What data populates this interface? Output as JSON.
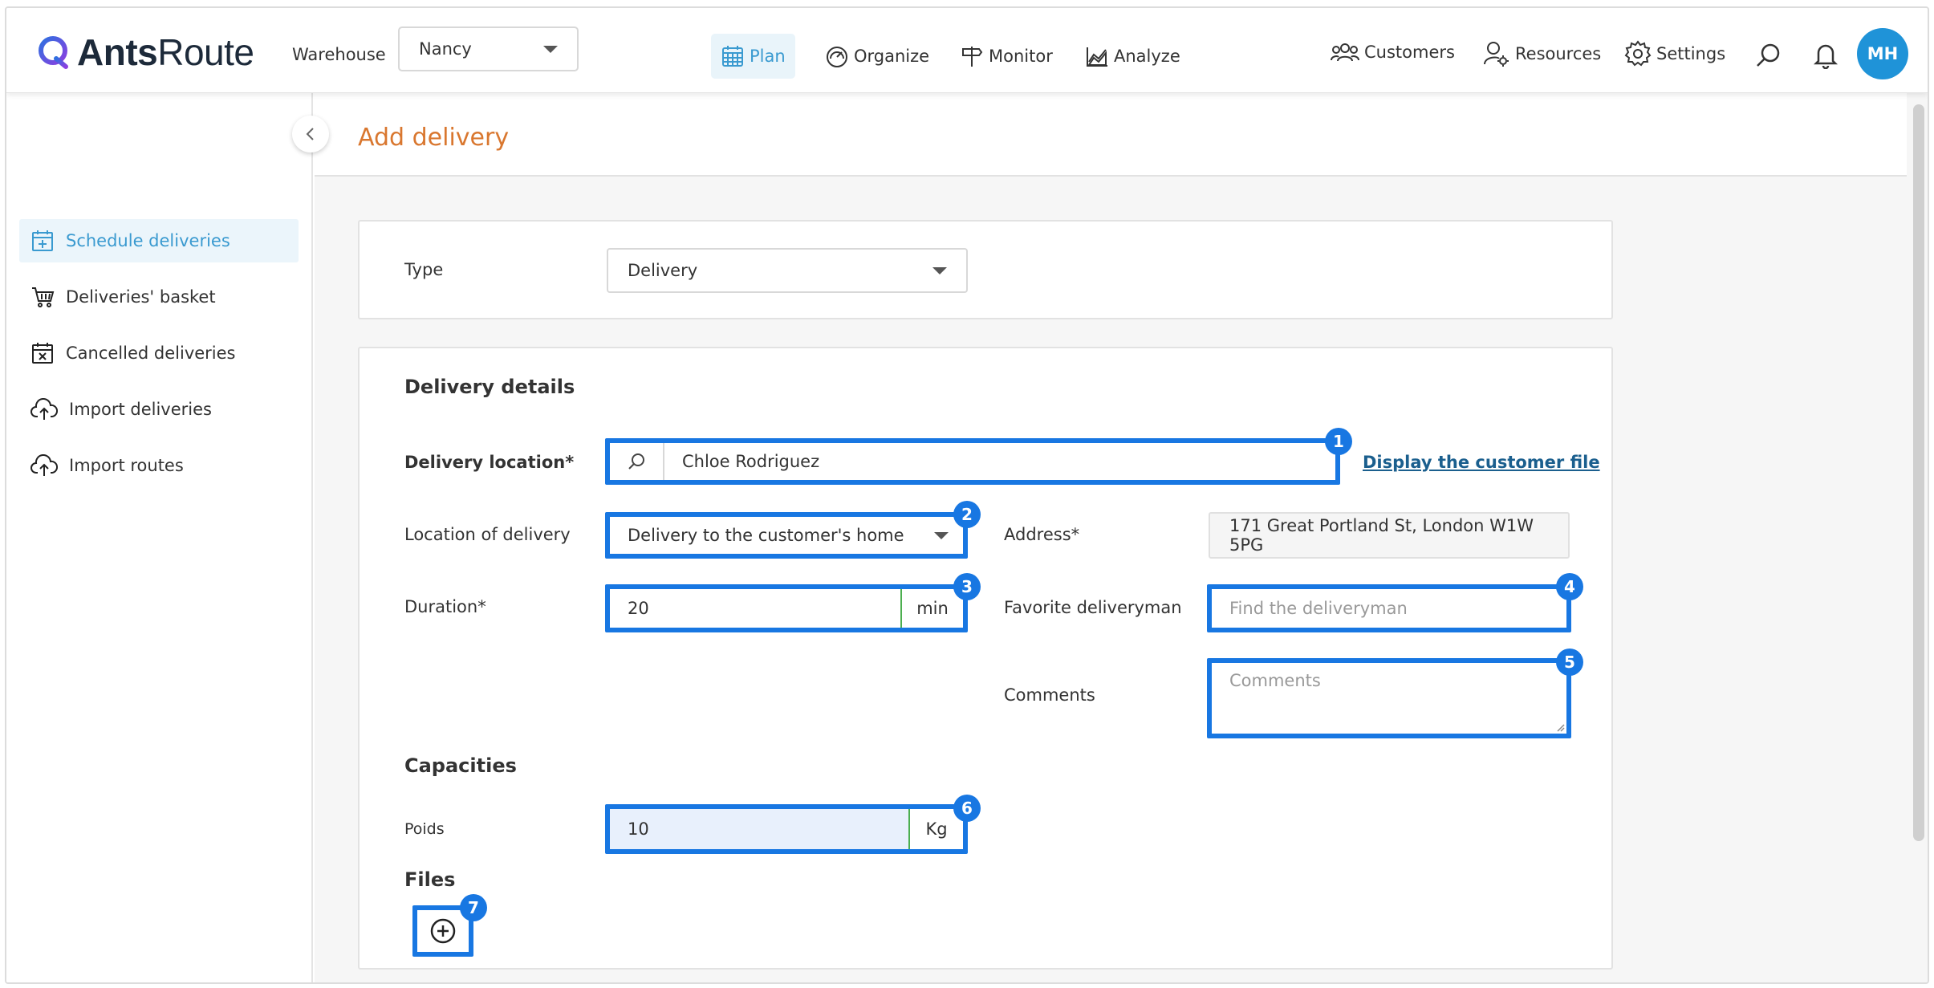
{
  "app": {
    "brand_prefix": "Ants",
    "brand_suffix": "Route",
    "brand_color": "#1d2a3a",
    "accent": "#1877e2"
  },
  "header": {
    "warehouse_label": "Warehouse",
    "warehouse_value": "Nancy",
    "nav": [
      {
        "label": "Plan",
        "icon": "calendar-grid-icon",
        "active": true
      },
      {
        "label": "Organize",
        "icon": "speedometer-icon",
        "active": false
      },
      {
        "label": "Monitor",
        "icon": "signpost-icon",
        "active": false
      },
      {
        "label": "Analyze",
        "icon": "chart-line-icon",
        "active": false
      }
    ],
    "right": [
      {
        "label": "Customers",
        "icon": "users-icon"
      },
      {
        "label": "Resources",
        "icon": "user-gear-icon"
      },
      {
        "label": "Settings",
        "icon": "gear-icon"
      }
    ],
    "avatar_initials": "MH",
    "avatar_color": "#1f93d8"
  },
  "sidebar": {
    "items": [
      {
        "label": "Schedule deliveries",
        "icon": "calendar-plus-icon",
        "active": true
      },
      {
        "label": "Deliveries' basket",
        "icon": "basket-icon",
        "active": false
      },
      {
        "label": "Cancelled deliveries",
        "icon": "calendar-x-icon",
        "active": false
      },
      {
        "label": "Import deliveries",
        "icon": "cloud-upload-icon",
        "active": false
      },
      {
        "label": "Import routes",
        "icon": "cloud-upload-icon",
        "active": false
      }
    ]
  },
  "page": {
    "title": "Add delivery",
    "title_color": "#d9772f",
    "type_label": "Type",
    "type_value": "Delivery",
    "details": {
      "title": "Delivery details",
      "location_label": "Delivery location*",
      "location_value": "Chloe Rodriguez",
      "customer_file_link": "Display the customer file",
      "location_of_delivery_label": "Location of delivery",
      "location_of_delivery_value": "Delivery to the customer's home",
      "address_label": "Address*",
      "address_value": "171 Great Portland St, London W1W 5PG",
      "duration_label": "Duration*",
      "duration_value": "20",
      "duration_unit": "min",
      "deliveryman_label": "Favorite deliveryman",
      "deliveryman_placeholder": "Find the deliveryman",
      "comments_label": "Comments",
      "comments_placeholder": "Comments"
    },
    "capacities": {
      "title": "Capacities",
      "weight_label": "Poids",
      "weight_value": "10",
      "weight_unit": "Kg"
    },
    "files": {
      "title": "Files"
    }
  },
  "annotations": [
    "1",
    "2",
    "3",
    "4",
    "5",
    "6",
    "7"
  ]
}
